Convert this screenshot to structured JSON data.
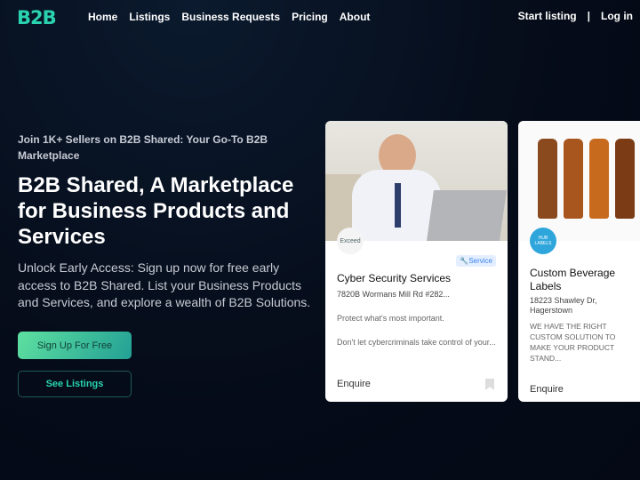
{
  "nav": {
    "logo": "B2B",
    "links": [
      "Home",
      "Listings",
      "Business Requests",
      "Pricing",
      "About"
    ],
    "start": "Start listing",
    "sep": "|",
    "login": "Log in"
  },
  "hero": {
    "kicker": "Join 1K+ Sellers on B2B Shared: Your Go-To B2B Marketplace",
    "title": "B2B Shared, A Marketplace for Business Products and Services",
    "desc": "Unlock Early Access: Sign up now for free early access to B2B Shared. List your Business Products and Services, and explore a wealth of B2B Solutions.",
    "signup": "Sign Up For Free",
    "see": "See Listings"
  },
  "cards": [
    {
      "logo": "Exceed",
      "badge": "Service",
      "title": "Cyber Security Services",
      "address": "7820B Wormans Mill Rd #282...",
      "p1": "Protect what's most important.",
      "p2": "Don't let cybercriminals take control of your...",
      "enquire": "Enquire"
    },
    {
      "logo": "HUB LABELS",
      "title": "Custom Beverage Labels",
      "address": "18223 Shawley Dr, Hagerstown",
      "p1": "WE HAVE THE RIGHT CUSTOM SOLUTION TO MAKE YOUR PRODUCT STAND...",
      "enquire": "Enquire"
    }
  ]
}
